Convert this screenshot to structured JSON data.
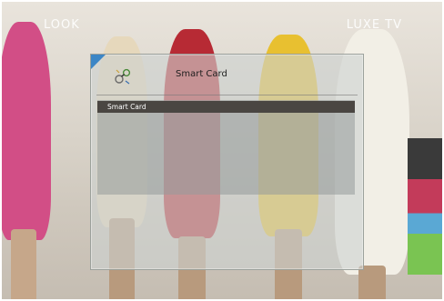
{
  "overlay": {
    "channel_left": "LOOK",
    "channel_right": "LUXE TV"
  },
  "dialog": {
    "title": "Smart Card",
    "icon": "smart-card-icon",
    "items": [
      {
        "label": "Smart Card",
        "selected": true
      }
    ]
  },
  "colors": {
    "corner_accent": "#3c86c6",
    "selected_row": "#4a4642"
  }
}
